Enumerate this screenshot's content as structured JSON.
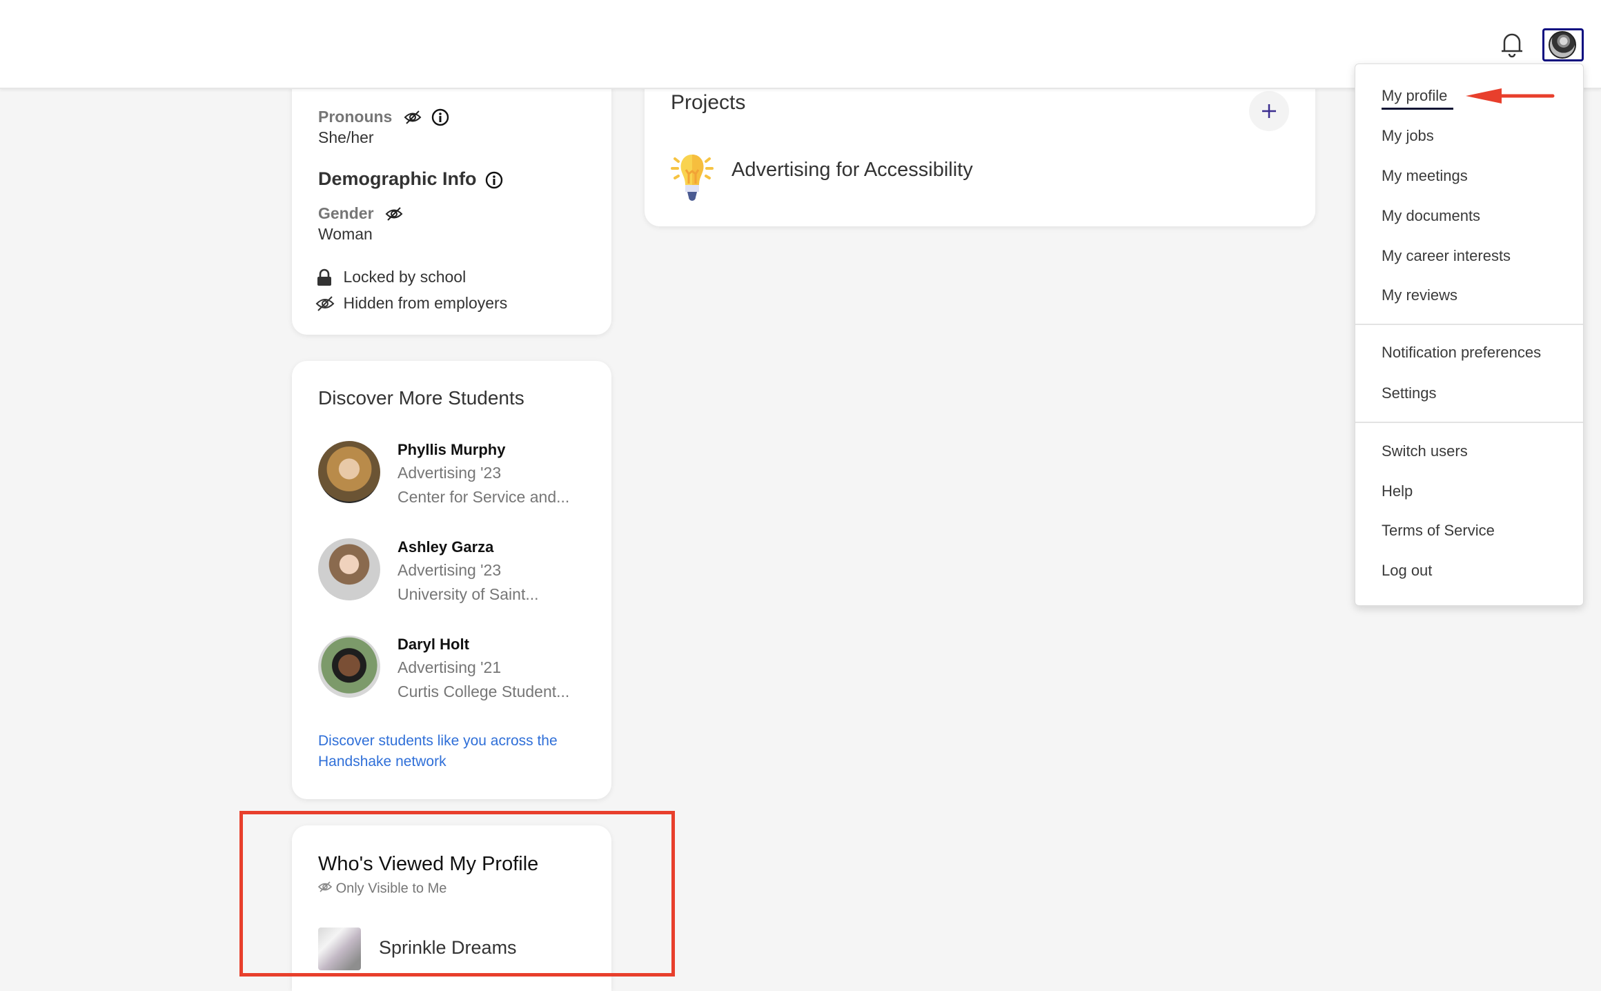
{
  "header": {
    "notifications_icon": "bell-icon",
    "avatar_icon": "user-avatar"
  },
  "profile_card": {
    "pronouns_label": "Pronouns",
    "pronouns_value": "She/her",
    "demographic_title": "Demographic Info",
    "gender_label": "Gender",
    "gender_value": "Woman",
    "legend": [
      {
        "icon": "lock-icon",
        "label": "Locked by school"
      },
      {
        "icon": "eye-slash-icon",
        "label": "Hidden from employers"
      }
    ]
  },
  "projects": {
    "title": "Projects",
    "add_icon": "plus-icon",
    "items": [
      {
        "icon": "lightbulb-icon",
        "title": "Advertising for Accessibility"
      }
    ]
  },
  "discover": {
    "title": "Discover More Students",
    "students": [
      {
        "name": "Phyllis Murphy",
        "major": "Advertising '23",
        "school": "Center for Service and..."
      },
      {
        "name": "Ashley Garza",
        "major": "Advertising '23",
        "school": "University of Saint..."
      },
      {
        "name": "Daryl Holt",
        "major": "Advertising '21",
        "school": "Curtis College Student..."
      }
    ],
    "link_line1": "Discover students like you across the",
    "link_line2": "Handshake network"
  },
  "viewers": {
    "title": "Who's Viewed My Profile",
    "subtitle": "Only Visible to Me",
    "items": [
      {
        "name": "Sprinkle Dreams"
      }
    ]
  },
  "menu": {
    "group1": [
      "My profile",
      "My jobs",
      "My meetings",
      "My documents",
      "My career interests",
      "My reviews"
    ],
    "group2": [
      "Notification preferences",
      "Settings"
    ],
    "group3": [
      "Switch users",
      "Help",
      "Terms of Service",
      "Log out"
    ],
    "active": "My profile"
  },
  "annotations": {
    "arrow_color": "#e83f2c",
    "box_color": "#e83f2c"
  }
}
